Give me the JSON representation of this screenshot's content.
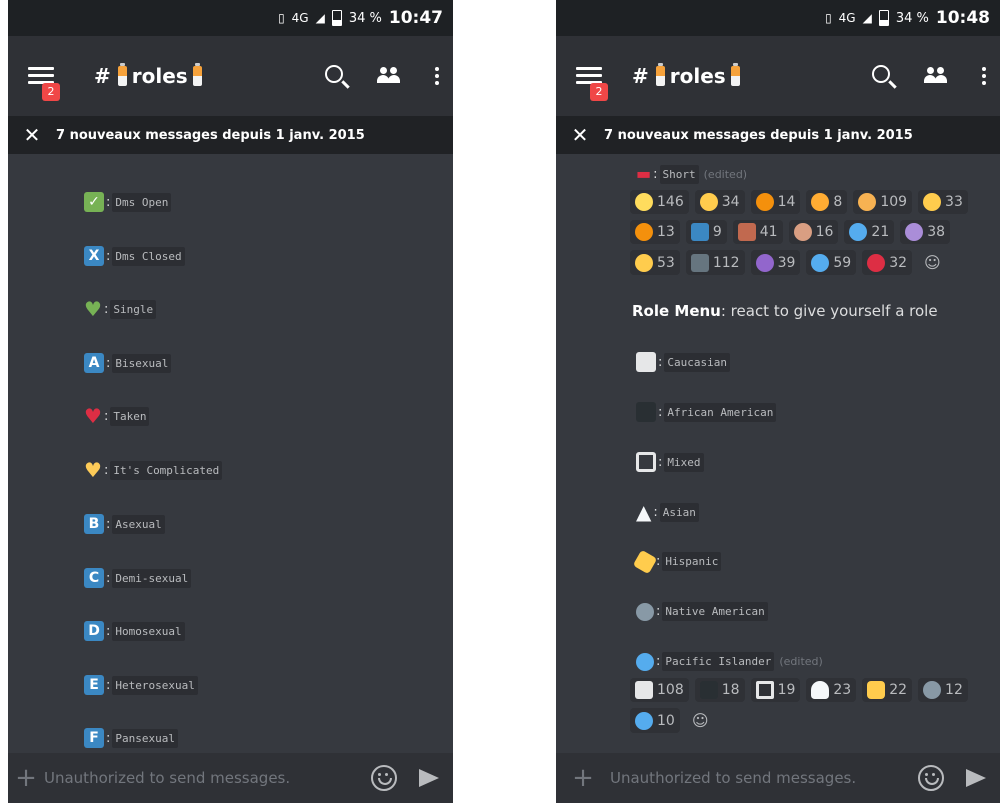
{
  "status": {
    "network": "4G",
    "battery": "34 %",
    "time_left": "10:47",
    "time_right": "10:48"
  },
  "header": {
    "hash": "#",
    "channel": "roles",
    "notif_count": "2"
  },
  "newbar": {
    "text": "7 nouveaux messages depuis 1 janv. 2015"
  },
  "input": {
    "placeholder": "Unauthorized to send messages."
  },
  "left_roles": [
    {
      "label": "Dms Open"
    },
    {
      "label": "Dms Closed",
      "letter": "X"
    },
    {
      "label": "Single"
    },
    {
      "label": "Bisexual",
      "letter": "A"
    },
    {
      "label": "Taken"
    },
    {
      "label": "It's Complicated"
    },
    {
      "label": "Asexual",
      "letter": "B"
    },
    {
      "label": "Demi-sexual",
      "letter": "C"
    },
    {
      "label": "Homosexual",
      "letter": "D"
    },
    {
      "label": "Heterosexual",
      "letter": "E"
    },
    {
      "label": "Pansexual",
      "letter": "F"
    }
  ],
  "right": {
    "short_label": "Short",
    "edited": "(edited)",
    "reactions_1": [
      "146",
      "34",
      "14",
      "8",
      "109",
      "33",
      "13",
      "9",
      "41",
      "16",
      "21",
      "38",
      "53",
      "112",
      "39",
      "59",
      "32"
    ],
    "role_menu_bold": "Role Menu",
    "role_menu_rest": ": react to give yourself a role",
    "roles": [
      {
        "label": "Caucasian"
      },
      {
        "label": "African American"
      },
      {
        "label": "Mixed"
      },
      {
        "label": "Asian"
      },
      {
        "label": "Hispanic"
      },
      {
        "label": "Native American"
      },
      {
        "label": "Pacific Islander"
      }
    ],
    "reactions_2": [
      "108",
      "18",
      "19",
      "23",
      "22",
      "12",
      "10"
    ]
  }
}
